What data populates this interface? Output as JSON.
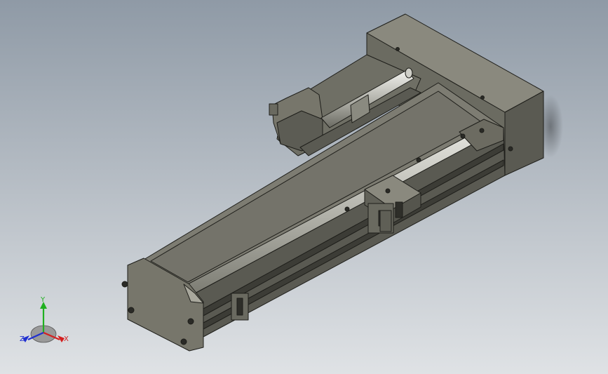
{
  "viewport": {
    "background_top": "#8f9aa6",
    "background_bottom": "#dfe2e5",
    "model_body_color": "#6e6e63",
    "model_light_color": "#8d8c80",
    "model_dark_color": "#4f4f47",
    "rail_highlight_color": "#c9c9c2",
    "edge_color": "#1e1e1a"
  },
  "triad": {
    "x_label": "X",
    "y_label": "Y",
    "z_label": "Z",
    "x_color": "#d32020",
    "y_color": "#20b020",
    "z_color": "#2030d0"
  }
}
